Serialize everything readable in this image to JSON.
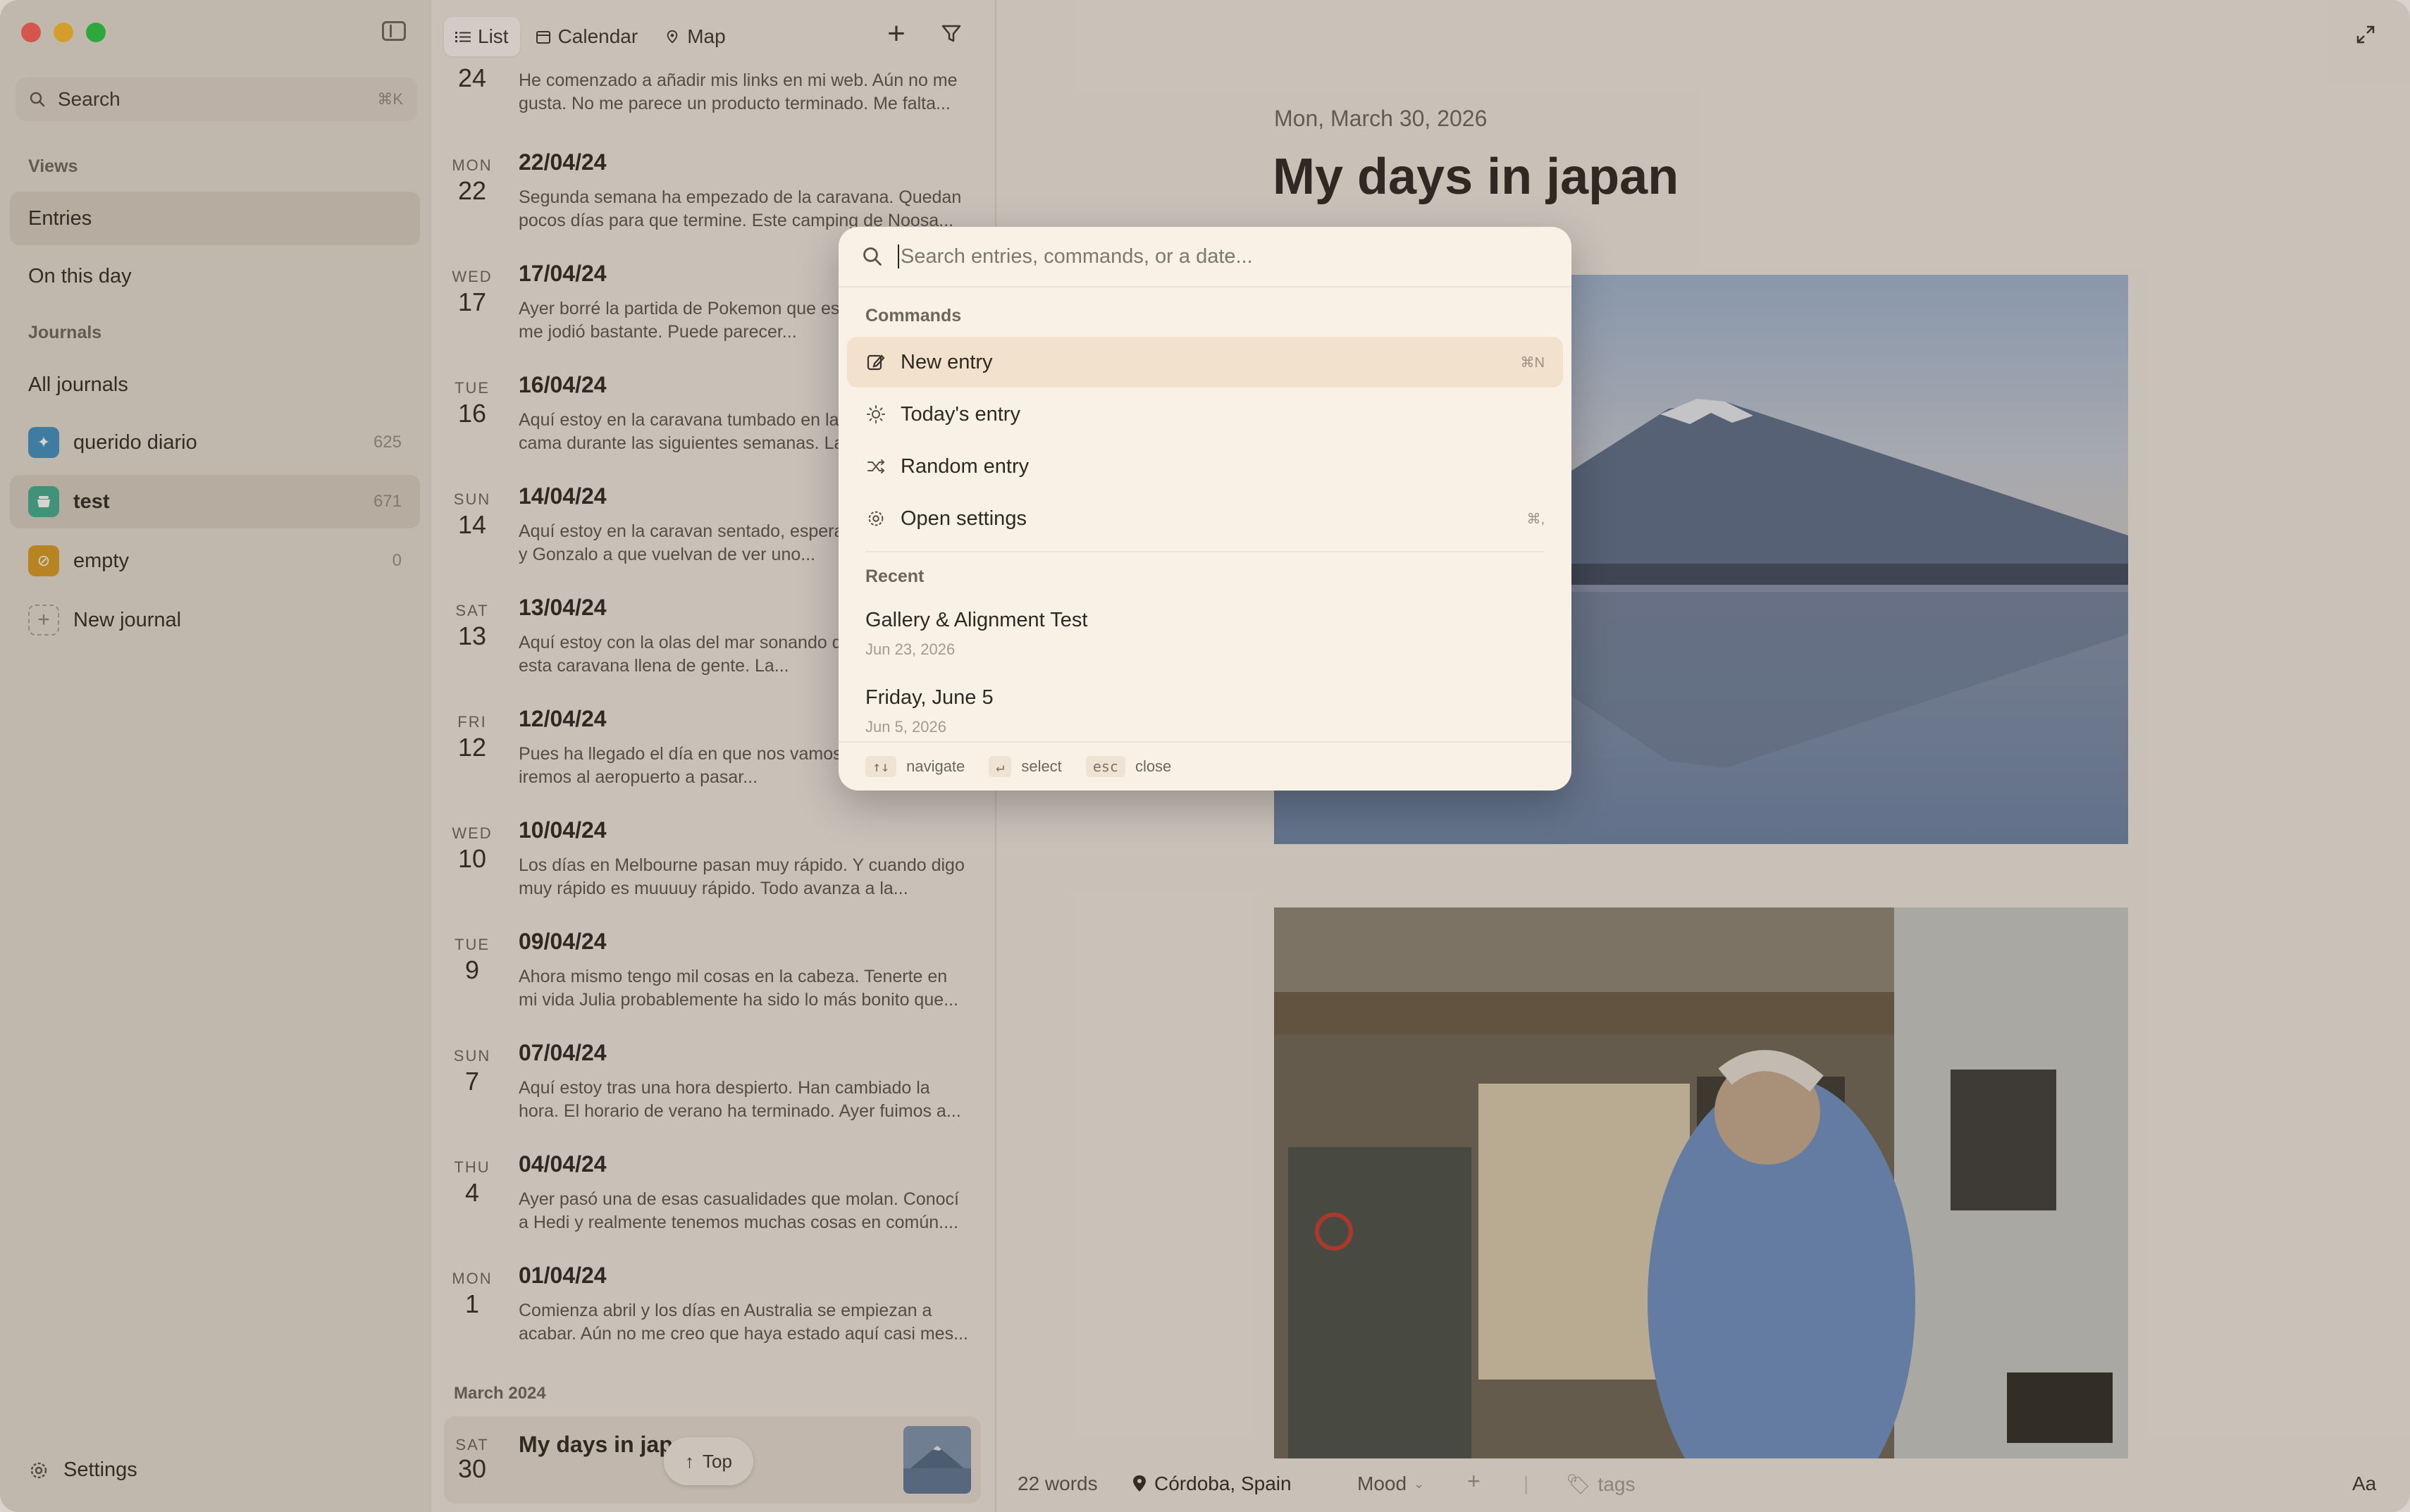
{
  "sidebar": {
    "search_label": "Search",
    "search_shortcut": "⌘K",
    "views_heading": "Views",
    "views": [
      {
        "label": "Entries"
      },
      {
        "label": "On this day"
      }
    ],
    "journals_heading": "Journals",
    "all_journals": "All journals",
    "journals": [
      {
        "name": "querido diario",
        "count": "625",
        "color": "#3f8fc4"
      },
      {
        "name": "test",
        "count": "671",
        "color": "#3fae8f"
      },
      {
        "name": "empty",
        "count": "0",
        "color": "#d89a1f"
      }
    ],
    "new_journal": "New journal",
    "settings_label": "Settings"
  },
  "list": {
    "tabs": [
      {
        "label": "List"
      },
      {
        "label": "Calendar"
      },
      {
        "label": "Map"
      }
    ],
    "entries": [
      {
        "dow": "",
        "day": "24",
        "title": "",
        "excerpt": "He comenzado a añadir mis links en mi web. Aún no me gusta. No me parece un producto terminado. Me falta..."
      },
      {
        "dow": "MON",
        "day": "22",
        "title": "22/04/24",
        "excerpt": "Segunda semana ha empezado de la caravana. Quedan pocos días para que termine. Este camping de Noosa..."
      },
      {
        "dow": "WED",
        "day": "17",
        "title": "17/04/24",
        "excerpt": "Ayer borré la partida de Pokemon que estaba jugando y me jodió bastante. Puede parecer..."
      },
      {
        "dow": "TUE",
        "day": "16",
        "title": "16/04/24",
        "excerpt": "Aquí estoy en la caravana tumbado en la que será mi cama durante las siguientes semanas. La..."
      },
      {
        "dow": "SUN",
        "day": "14",
        "title": "14/04/24",
        "excerpt": "Aquí estoy en la caravan sentado, esperando a que Cris y Gonzalo a que vuelvan de ver uno..."
      },
      {
        "dow": "SAT",
        "day": "13",
        "title": "13/04/24",
        "excerpt": "Aquí estoy con la olas del mar sonando de fondo. En esta caravana llena de gente. La..."
      },
      {
        "dow": "FRI",
        "day": "12",
        "title": "12/04/24",
        "excerpt": "Pues ha llegado el día en que nos vamos. En unas horas iremos al aeropuerto a pasar..."
      },
      {
        "dow": "WED",
        "day": "10",
        "title": "10/04/24",
        "excerpt": "Los días en Melbourne pasan muy rápido. Y cuando digo muy rápido es muuuuy rápido. Todo avanza a la..."
      },
      {
        "dow": "TUE",
        "day": "9",
        "title": "09/04/24",
        "excerpt": "Ahora mismo tengo mil cosas en la cabeza. Tenerte en mi vida Julia probablemente ha sido lo más bonito que..."
      },
      {
        "dow": "SUN",
        "day": "7",
        "title": "07/04/24",
        "excerpt": "Aquí estoy tras una hora despierto. Han cambiado la hora. El horario de verano ha terminado. Ayer fuimos a..."
      },
      {
        "dow": "THU",
        "day": "4",
        "title": "04/04/24",
        "excerpt": "Ayer pasó una de esas casualidades que molan. Conocí a Hedi y realmente tenemos muchas cosas en común...."
      },
      {
        "dow": "MON",
        "day": "1",
        "title": "01/04/24",
        "excerpt": "Comienza abril y los días en Australia se empiezan a acabar. Aún no me creo que haya estado aquí casi mes..."
      }
    ],
    "month_heading": "March 2024",
    "selected": {
      "dow": "SAT",
      "day": "30",
      "title": "My days in japan"
    },
    "top_button": "Top"
  },
  "main": {
    "date": "Mon, March 30, 2026",
    "title": "My days in japan",
    "status": {
      "words": "22 words",
      "location": "Córdoba, Spain",
      "mood": "Mood",
      "tags": "tags",
      "font_toggle": "Aa"
    }
  },
  "palette": {
    "placeholder": "Search entries, commands, or a date...",
    "commands_heading": "Commands",
    "commands": [
      {
        "label": "New entry",
        "shortcut": "⌘N",
        "icon": "edit-icon"
      },
      {
        "label": "Today's entry",
        "shortcut": "",
        "icon": "sun-icon"
      },
      {
        "label": "Random entry",
        "shortcut": "",
        "icon": "shuffle-icon"
      },
      {
        "label": "Open settings",
        "shortcut": "⌘,",
        "icon": "gear-icon"
      }
    ],
    "recent_heading": "Recent",
    "recent": [
      {
        "title": "Gallery & Alignment Test",
        "date": "Jun 23, 2026"
      },
      {
        "title": "Friday, June 5",
        "date": "Jun 5, 2026"
      }
    ],
    "footer": {
      "navigate_key": "↑↓",
      "navigate": "navigate",
      "select_key": "↵",
      "select": "select",
      "close_key": "esc",
      "close": "close"
    }
  }
}
